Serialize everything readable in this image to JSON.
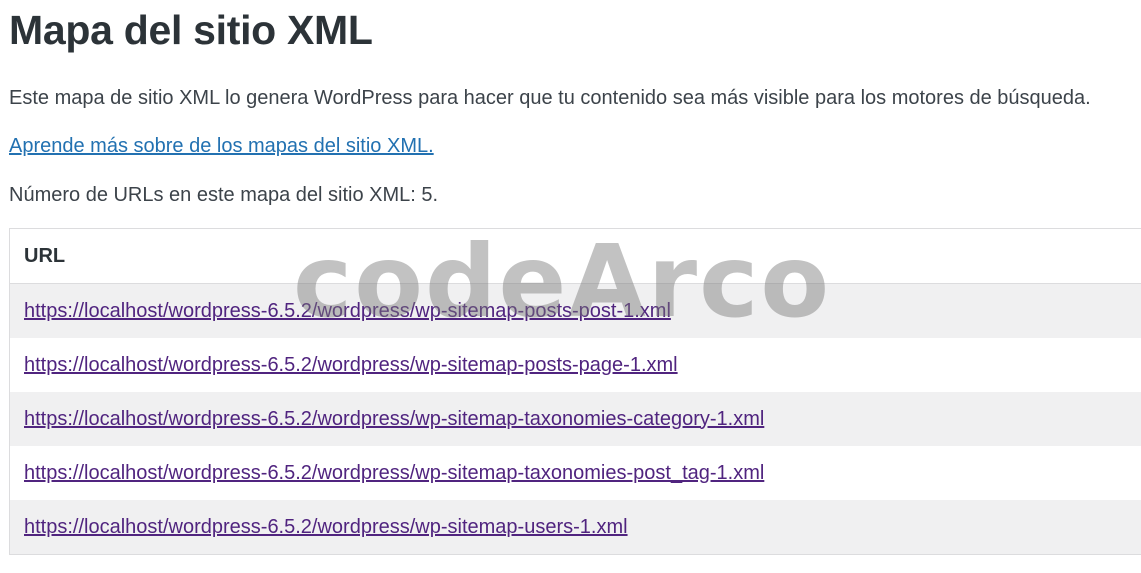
{
  "page": {
    "title": "Mapa del sitio XML",
    "description": "Este mapa de sitio XML lo genera WordPress para hacer que tu contenido sea más visible para los motores de búsqueda.",
    "learn_more_link": "Aprende más sobre de los mapas del sitio XML.",
    "url_count_text": "Número de URLs en este mapa del sitio XML: 5."
  },
  "table": {
    "header": "URL",
    "rows": [
      "https://localhost/wordpress-6.5.2/wordpress/wp-sitemap-posts-post-1.xml",
      "https://localhost/wordpress-6.5.2/wordpress/wp-sitemap-posts-page-1.xml",
      "https://localhost/wordpress-6.5.2/wordpress/wp-sitemap-taxonomies-category-1.xml",
      "https://localhost/wordpress-6.5.2/wordpress/wp-sitemap-taxonomies-post_tag-1.xml",
      "https://localhost/wordpress-6.5.2/wordpress/wp-sitemap-users-1.xml"
    ]
  },
  "watermark": "codeArco",
  "colors": {
    "link": "#2271b1",
    "visited_link": "#50247f",
    "row_stripe": "#f0f0f1",
    "border": "#dcdcde"
  }
}
